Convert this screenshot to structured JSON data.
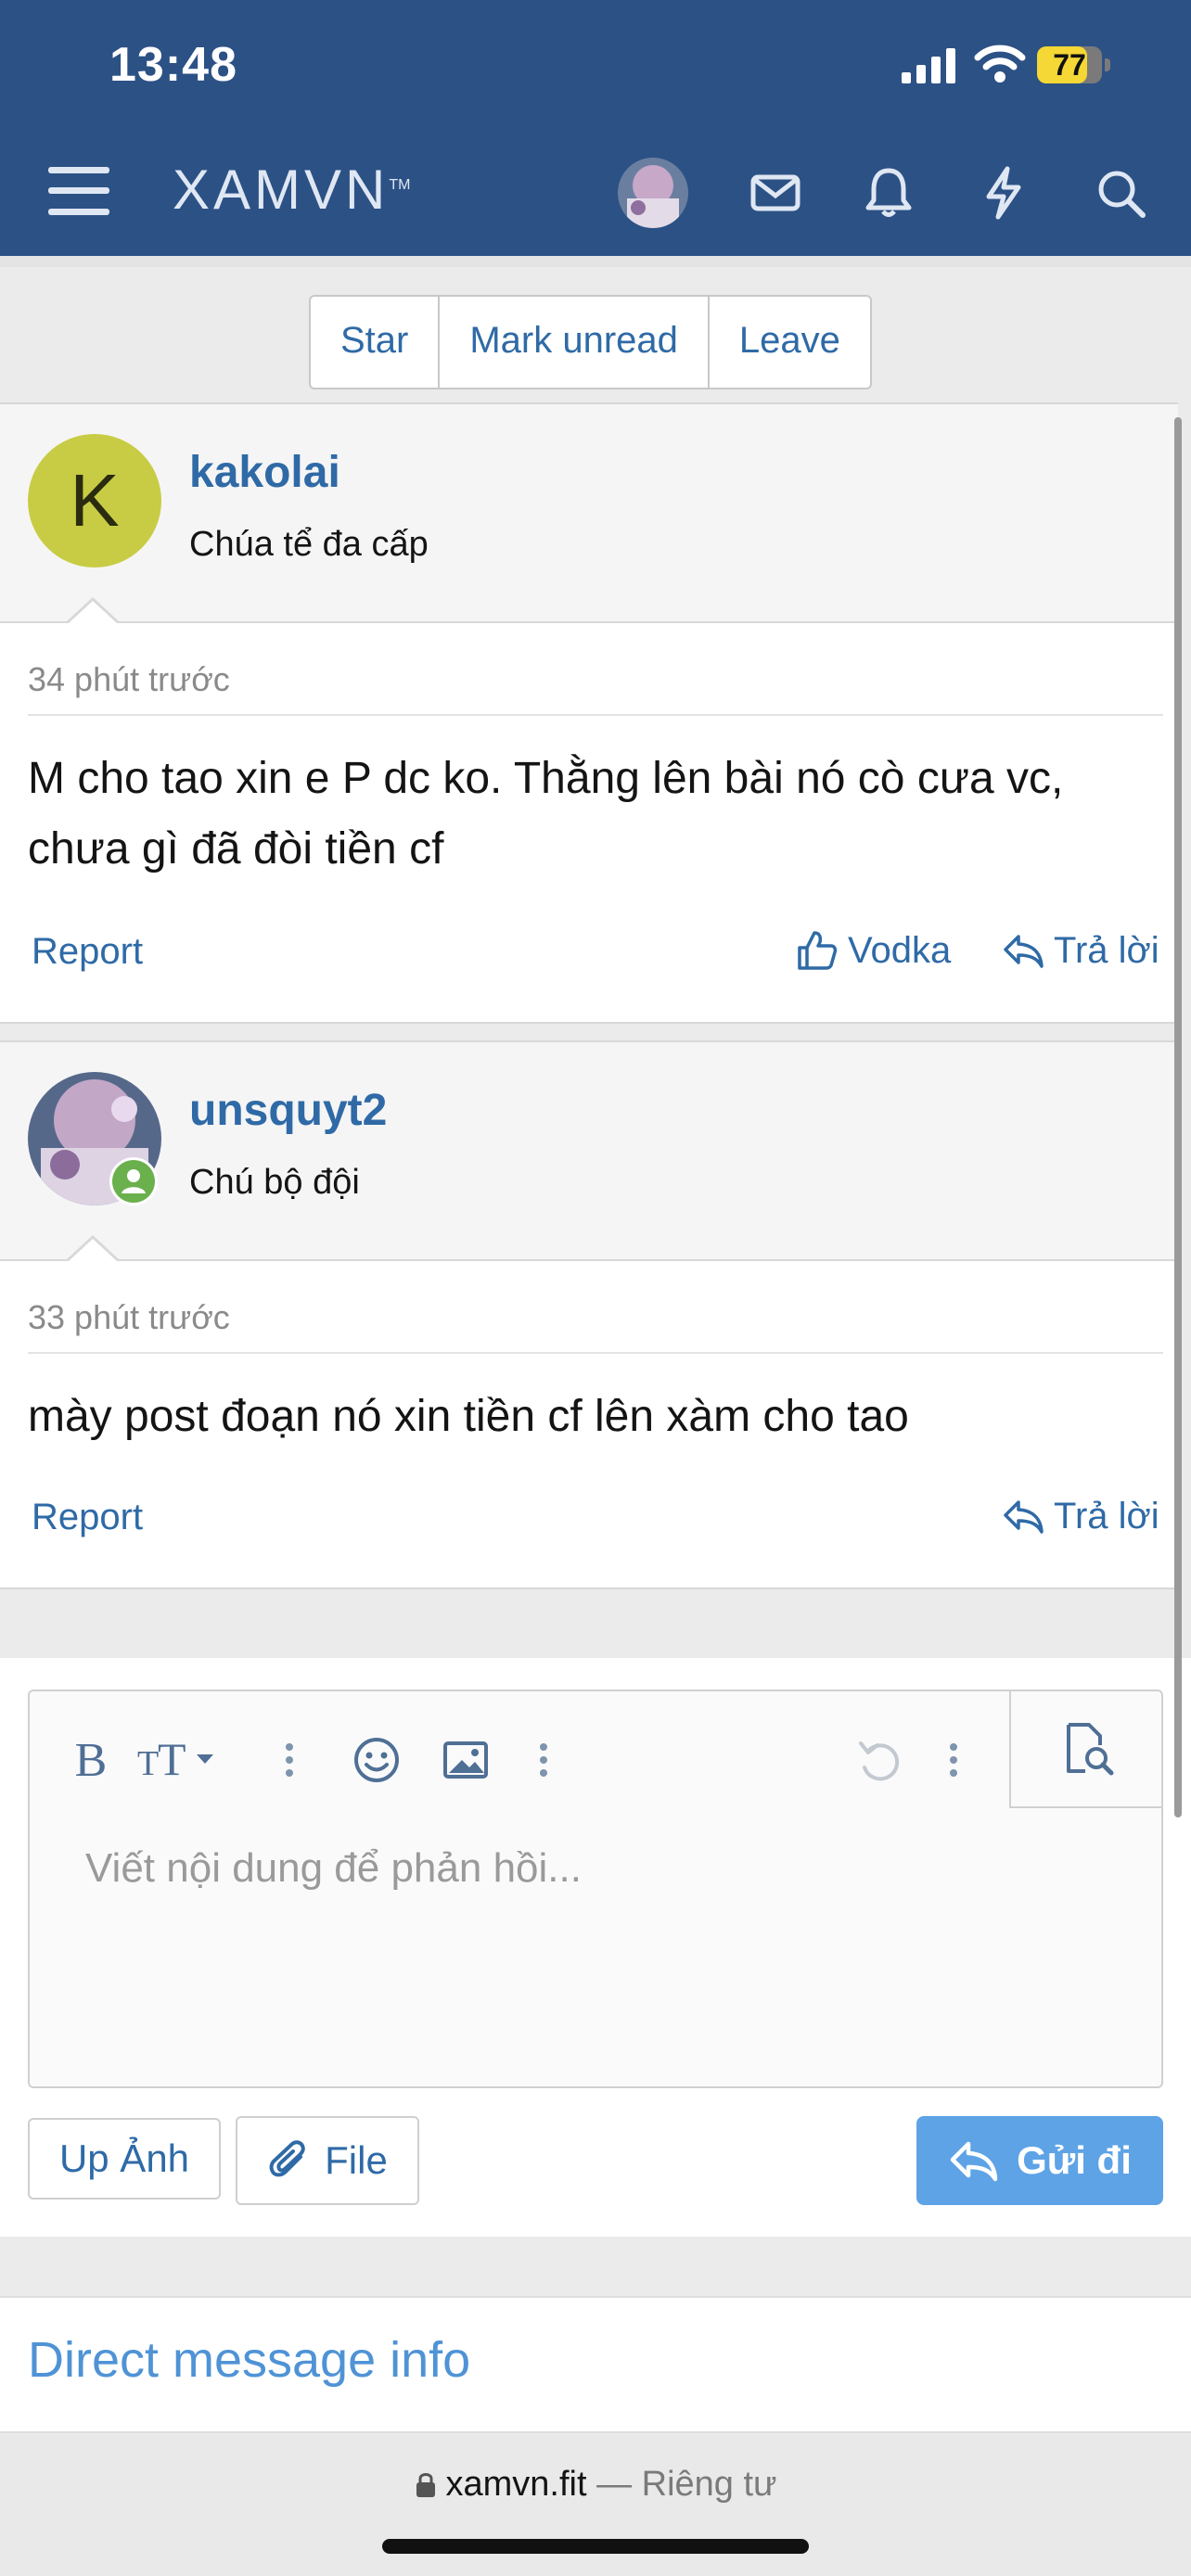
{
  "status_bar": {
    "time": "13:48",
    "battery": "77"
  },
  "header": {
    "logo": "XAMVN",
    "logo_tm": "TM"
  },
  "conversation_actions": {
    "star": "Star",
    "mark_unread": "Mark unread",
    "leave": "Leave"
  },
  "messages": [
    {
      "avatar_letter": "K",
      "avatar_color": "#c8cc44",
      "username": "kakolai",
      "user_title": "Chúa tể đa cấp",
      "time": "34 phút trước",
      "body_line1": "M cho tao xin e P dc ko. Thằng lên bài nó cò cưa vc,",
      "body_line2": "chưa gì đã đòi tiền cf",
      "report": "Report",
      "like": "Vodka",
      "reply": "Trả lời"
    },
    {
      "username": "unsquyt2",
      "user_title": "Chú bộ đội",
      "time": "33 phút trước",
      "body_line1": "mày post đoạn nó xin tiền cf lên xàm cho tao",
      "report": "Report",
      "reply": "Trả lời"
    }
  ],
  "editor": {
    "placeholder": "Viết nội dung để phản hồi...",
    "bold": "B",
    "upload_photo": "Up Ảnh",
    "file": "File",
    "send": "Gửi đi"
  },
  "direct_message_info": "Direct message info",
  "browser": {
    "domain": "xamvn.fit",
    "separator": "—",
    "privacy": "Riêng tư"
  },
  "colors": {
    "header": "#2c5185",
    "link": "#2f6aa6",
    "send": "#5ea3e6",
    "online": "#6ab04c"
  }
}
